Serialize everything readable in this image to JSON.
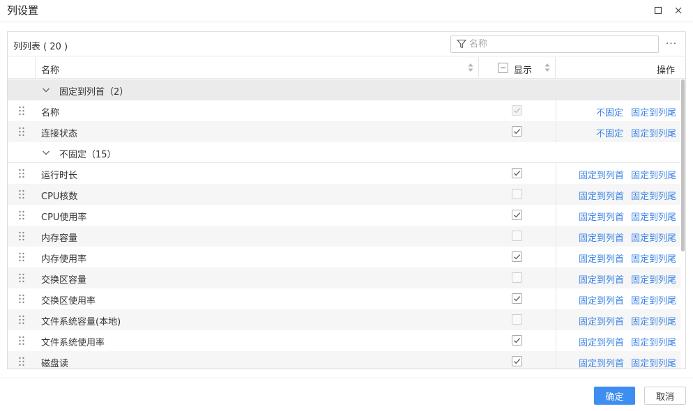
{
  "dialog": {
    "title": "列设置"
  },
  "toolbar": {
    "list_label": "列列表 ( 20 )",
    "search_placeholder": "名称",
    "more_label": "···"
  },
  "header": {
    "name": "名称",
    "display": "显示",
    "actions": "操作"
  },
  "groups": [
    {
      "label": "固定到列首（2）",
      "rows": [
        {
          "name": "名称",
          "visible": true,
          "checkbox_disabled": true,
          "actions": [
            "不固定",
            "固定到列尾"
          ]
        },
        {
          "name": "连接状态",
          "visible": true,
          "checkbox_disabled": false,
          "actions": [
            "不固定",
            "固定到列尾"
          ]
        }
      ]
    },
    {
      "label": "不固定（15）",
      "rows": [
        {
          "name": "运行时长",
          "visible": true,
          "actions": [
            "固定到列首",
            "固定到列尾"
          ]
        },
        {
          "name": "CPU核数",
          "visible": false,
          "actions": [
            "固定到列首",
            "固定到列尾"
          ]
        },
        {
          "name": "CPU使用率",
          "visible": true,
          "actions": [
            "固定到列首",
            "固定到列尾"
          ]
        },
        {
          "name": "内存容量",
          "visible": false,
          "actions": [
            "固定到列首",
            "固定到列尾"
          ]
        },
        {
          "name": "内存使用率",
          "visible": true,
          "actions": [
            "固定到列首",
            "固定到列尾"
          ]
        },
        {
          "name": "交换区容量",
          "visible": false,
          "actions": [
            "固定到列首",
            "固定到列尾"
          ]
        },
        {
          "name": "交换区使用率",
          "visible": true,
          "actions": [
            "固定到列首",
            "固定到列尾"
          ]
        },
        {
          "name": "文件系统容量(本地)",
          "visible": false,
          "actions": [
            "固定到列首",
            "固定到列尾"
          ]
        },
        {
          "name": "文件系统使用率",
          "visible": true,
          "actions": [
            "固定到列首",
            "固定到列尾"
          ]
        },
        {
          "name": "磁盘读",
          "visible": true,
          "actions": [
            "固定到列首",
            "固定到列尾"
          ]
        }
      ]
    }
  ],
  "footer": {
    "ok_label": "确定",
    "cancel_label": "取消"
  },
  "colors": {
    "accent": "#3d8ef0",
    "link": "#3b84e6"
  },
  "icons": [
    "maximize-icon",
    "close-icon",
    "filter-icon",
    "more-icon",
    "sort-icon",
    "chevron-down-icon",
    "drag-handle-icon",
    "check-icon"
  ]
}
